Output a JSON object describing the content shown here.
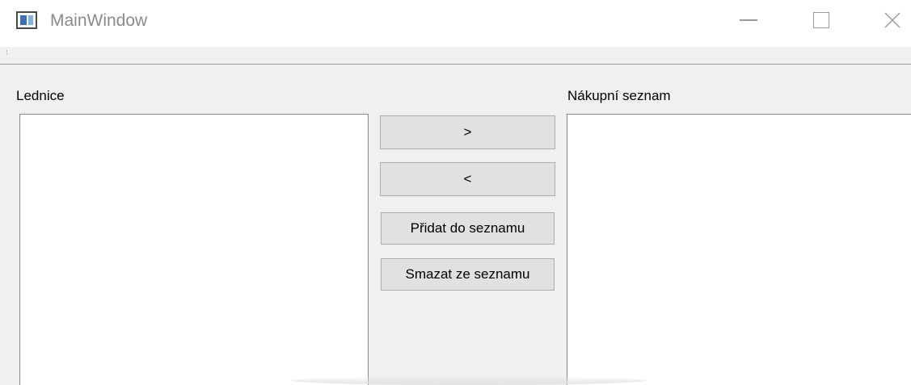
{
  "window": {
    "title": "MainWindow"
  },
  "titlebar_buttons": {
    "minimize_icon": "minimize-icon",
    "maximize_icon": "maximize-icon",
    "close_icon": "close-icon",
    "close_glyph": "✕"
  },
  "labels": {
    "fridge": "Lednice",
    "shopping_list": "Nákupní seznam"
  },
  "buttons": {
    "move_right": ">",
    "move_left": "<",
    "add_to_list": "Přidat do seznamu",
    "remove_from_list": "Smazat ze seznamu"
  },
  "lists": {
    "fridge_items": [],
    "shopping_items": []
  }
}
